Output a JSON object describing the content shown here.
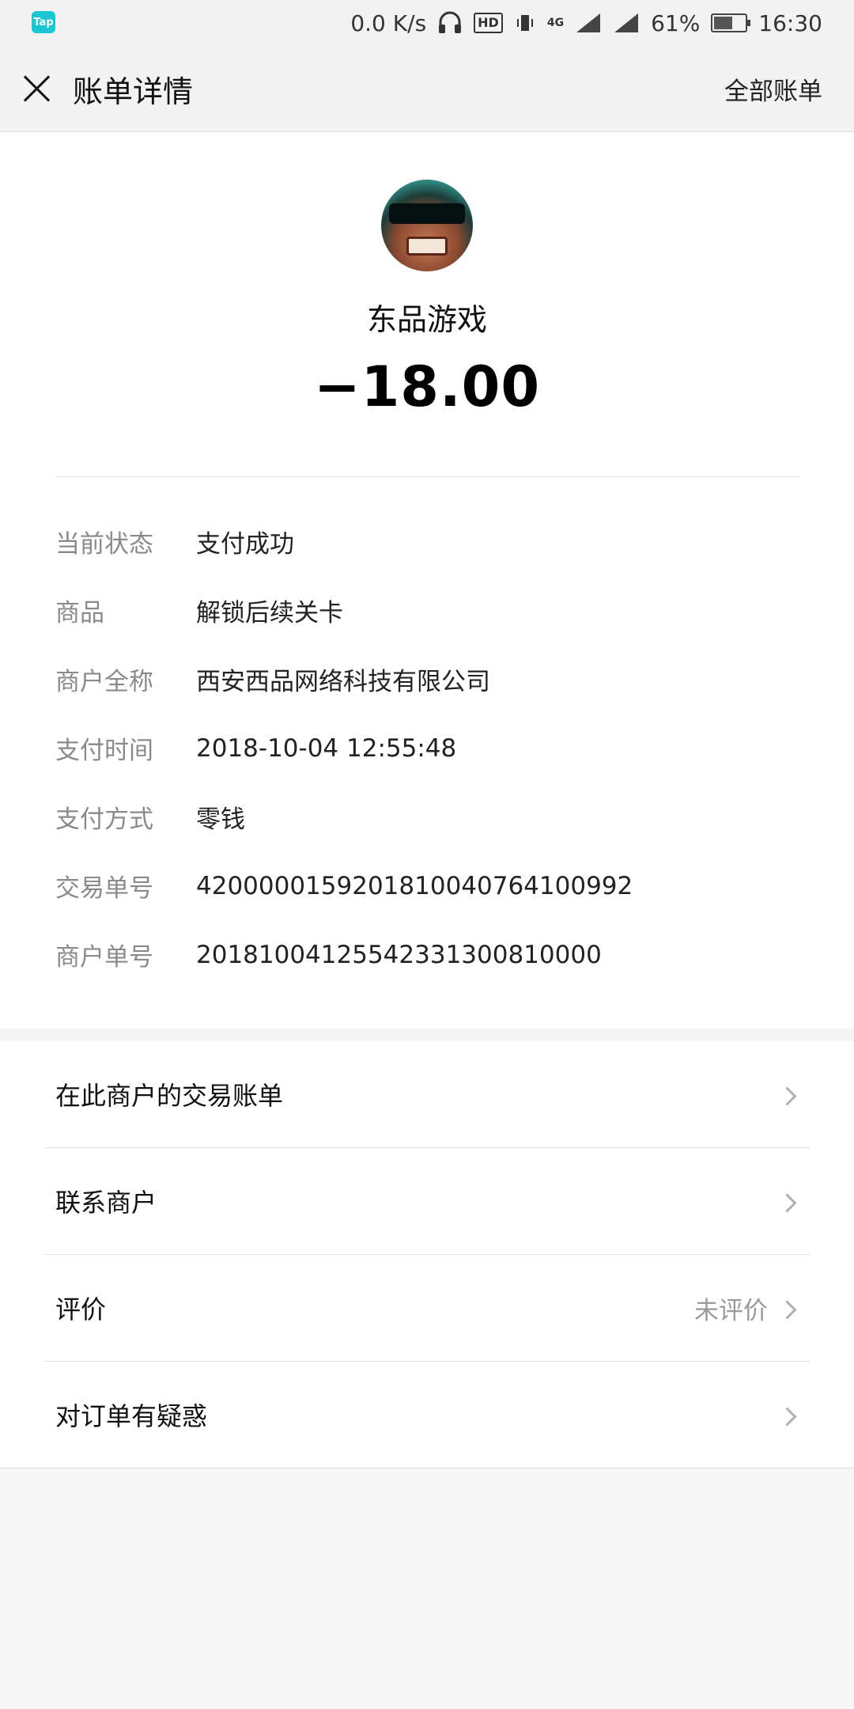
{
  "status_bar": {
    "speed": "0.0 K/s",
    "hd_badge": "HD",
    "network": "4G",
    "battery": "61%",
    "battery_level": 0.61,
    "time": "16:30",
    "app_badge": "Tap",
    "icons": [
      "tap-app-icon",
      "headphones-icon",
      "vibrate-icon",
      "signal-icon",
      "signal-icon",
      "battery-icon"
    ]
  },
  "nav": {
    "title": "账单详情",
    "right_link": "全部账单",
    "close_icon": "close-icon"
  },
  "merchant": {
    "name": "东品游戏",
    "amount": "−18.00"
  },
  "details": [
    {
      "label": "当前状态",
      "value": "支付成功"
    },
    {
      "label": "商品",
      "value": "解锁后续关卡"
    },
    {
      "label": "商户全称",
      "value": "西安西品网络科技有限公司"
    },
    {
      "label": "支付时间",
      "value": "2018-10-04 12:55:48"
    },
    {
      "label": "支付方式",
      "value": "零钱"
    },
    {
      "label": "交易单号",
      "value": "4200000159201810040764100992"
    },
    {
      "label": "商户单号",
      "value": "20181004125542331300810000"
    }
  ],
  "menu": [
    {
      "label": "在此商户的交易账单",
      "value": ""
    },
    {
      "label": "联系商户",
      "value": ""
    },
    {
      "label": "评价",
      "value": "未评价"
    },
    {
      "label": "对订单有疑惑",
      "value": ""
    }
  ],
  "colors": {
    "nav_background": "#f2f2f2",
    "page_background": "#f7f7f7",
    "label_gray": "#8a8a8a",
    "app_badge": "#19c6d2"
  }
}
